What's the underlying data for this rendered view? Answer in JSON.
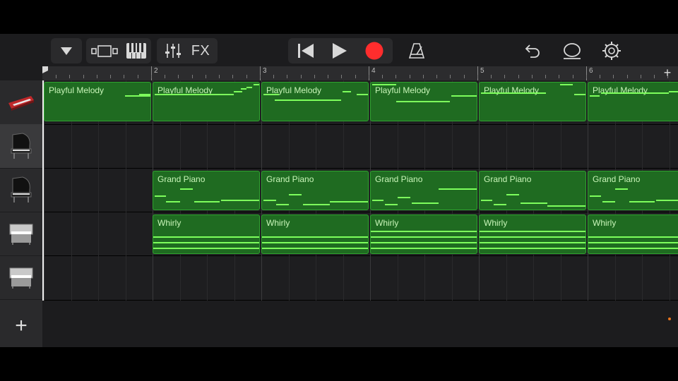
{
  "toolbar": {
    "fx_label": "FX",
    "buttons": [
      "browser-dropdown",
      "tracks-view",
      "keyboard-view",
      "mixer",
      "fx",
      "rewind",
      "play",
      "record",
      "metronome",
      "undo",
      "loop",
      "settings"
    ],
    "record_color": "#ff2d2d"
  },
  "ruler": {
    "bar_numbers": [
      "2",
      "3",
      "4",
      "5",
      "6"
    ],
    "add_label": "+"
  },
  "tracks": [
    {
      "instrument": "synth-keyboard",
      "regions": [
        {
          "label": "Playful Melody"
        },
        {
          "label": "Playful Melody"
        },
        {
          "label": "Playful Melody"
        },
        {
          "label": "Playful Melody"
        },
        {
          "label": "Playful Melody"
        },
        {
          "label": "Playful Melody"
        }
      ]
    },
    {
      "instrument": "grand-piano",
      "regions": []
    },
    {
      "instrument": "grand-piano",
      "regions": [
        {
          "label": "Grand Piano"
        },
        {
          "label": "Grand Piano"
        },
        {
          "label": "Grand Piano"
        },
        {
          "label": "Grand Piano"
        },
        {
          "label": "Grand Piano"
        }
      ]
    },
    {
      "instrument": "electric-piano",
      "regions": [
        {
          "label": "Whirly"
        },
        {
          "label": "Whirly"
        },
        {
          "label": "Whirly"
        },
        {
          "label": "Whirly"
        },
        {
          "label": "Whirly"
        }
      ]
    },
    {
      "instrument": "electric-piano",
      "regions": []
    }
  ],
  "add_track_label": "+",
  "colors": {
    "region_fill": "#1f6b21",
    "region_border": "#2fa32f",
    "note": "#7dff5c",
    "label": "#c8f5b8"
  }
}
